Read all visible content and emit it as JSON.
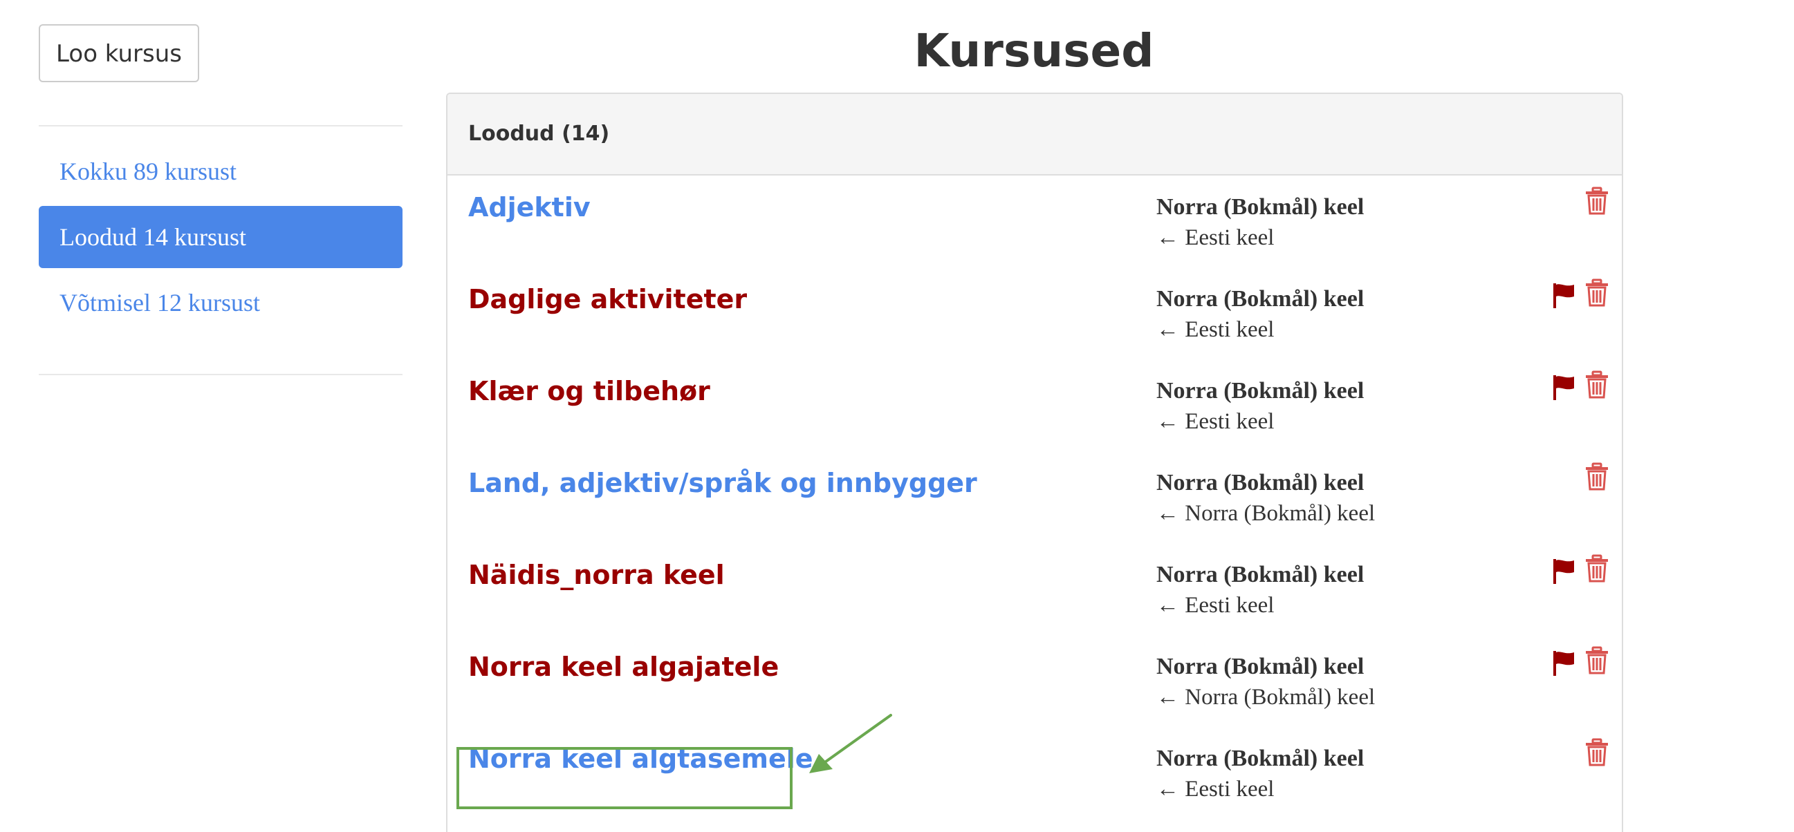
{
  "sidebar": {
    "create_button": "Loo kursus",
    "items": [
      {
        "label": "Kokku 89 kursust",
        "active": false
      },
      {
        "label": "Loodud 14 kursust",
        "active": true
      },
      {
        "label": "Võtmisel 12 kursust",
        "active": false
      }
    ]
  },
  "main": {
    "title": "Kursused",
    "panel_heading": "Loodud (14)",
    "courses": [
      {
        "name": "Adjektiv",
        "color": "blue",
        "target": "Norra (Bokmål) keel",
        "source": "← Eesti keel",
        "flagged": false
      },
      {
        "name": "Daglige aktiviteter",
        "color": "red",
        "target": "Norra (Bokmål) keel",
        "source": "← Eesti keel",
        "flagged": true
      },
      {
        "name": "Klær og tilbehør",
        "color": "red",
        "target": "Norra (Bokmål) keel",
        "source": "← Eesti keel",
        "flagged": true
      },
      {
        "name": "Land, adjektiv/språk og innbygger",
        "color": "blue",
        "target": "Norra (Bokmål) keel",
        "source": "← Norra (Bokmål) keel",
        "flagged": false
      },
      {
        "name": "Näidis_norra keel",
        "color": "red",
        "target": "Norra (Bokmål) keel",
        "source": "← Eesti keel",
        "flagged": true
      },
      {
        "name": "Norra keel algajatele",
        "color": "red",
        "target": "Norra (Bokmål) keel",
        "source": "← Norra (Bokmål) keel",
        "flagged": true
      },
      {
        "name": "Norra keel algtasemele",
        "color": "blue",
        "target": "Norra (Bokmål) keel",
        "source": "← Eesti keel",
        "flagged": false
      }
    ]
  },
  "colors": {
    "accent_blue": "#4a86e8",
    "dark_red": "#990000",
    "trash_red": "#d9534f",
    "highlight_green": "#6aa84f"
  },
  "icons": {
    "flag": "flag-icon",
    "trash": "trash-icon"
  }
}
